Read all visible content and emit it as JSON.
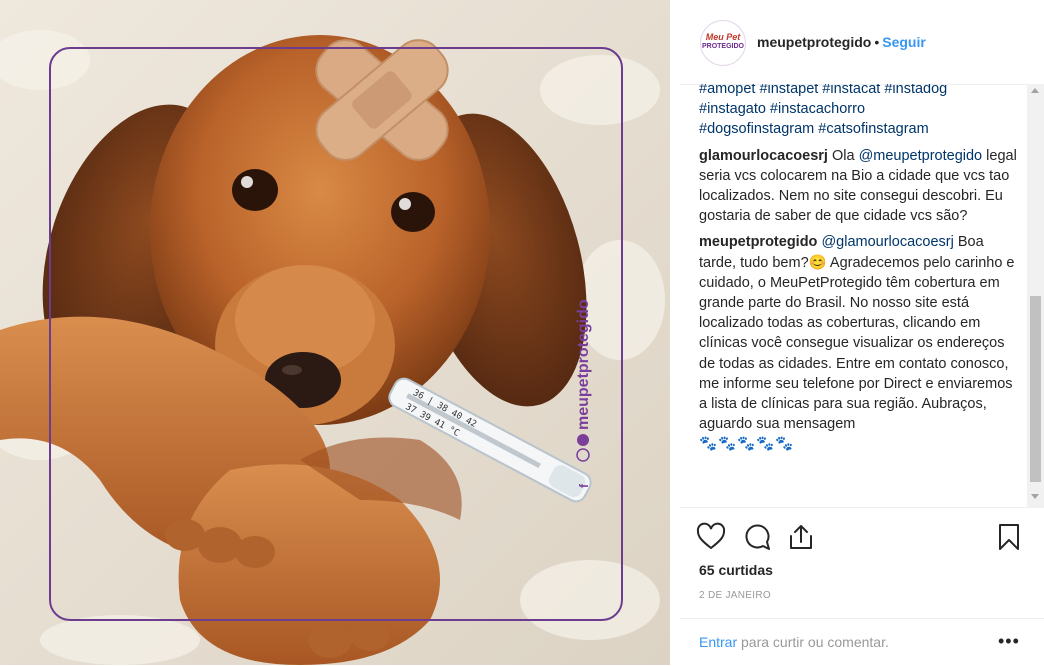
{
  "header": {
    "avatar_line1": "Meu Pet",
    "avatar_line2": "PROTEGIDO",
    "username": "meupetprotegido",
    "dot": "•",
    "follow_label": "Seguir"
  },
  "photo": {
    "watermark": "meupetprotegido",
    "thermometer_scale": "36 | 38  40  42",
    "thermometer_scale2": "37  39  41 °C",
    "colors": {
      "frame": "#6c3d8f",
      "fur": "#c26a2a",
      "blanket": "#ece5d9",
      "bandage": "#d9aa83"
    }
  },
  "caption": {
    "hashtags": [
      "#amopet",
      "#instapet",
      "#instacat",
      "#instadog",
      "#instagato",
      "#instacachorro",
      "#dogsofinstagram",
      "#catsofinstagram"
    ]
  },
  "comments": [
    {
      "user": "glamourlocacoesrj",
      "pre": "Ola ",
      "mention": "@meupetprotegido",
      "text": " legal seria vcs colocarem na Bio a cidade que vcs tao localizados. Nem no site consegui descobri. Eu gostaria de saber de que cidade vcs são?"
    },
    {
      "user": "meupetprotegido",
      "pre": "",
      "mention": "@glamourlocacoesrj",
      "text": " Boa tarde, tudo bem?😊 Agradecemos pelo carinho e cuidado, o MeuPetProtegido têm cobertura em grande parte do Brasil. No nosso site está localizado todas as coberturas, clicando em clínicas você consegue visualizar os endereços de todas as cidades. Entre em contato conosco, me informe seu telefone por Direct e enviaremos a lista de clínicas para sua região. Aubraços, aguardo sua mensagem",
      "paws": "🐾🐾🐾🐾🐾"
    }
  ],
  "actions": {
    "icons": [
      "heart-icon",
      "comment-icon",
      "share-icon",
      "bookmark-icon"
    ],
    "likes": "65 curtidas",
    "date": "2 DE JANEIRO"
  },
  "comment_bar": {
    "enter": "Entrar",
    "rest": " para curtir ou comentar.",
    "more": "•••"
  }
}
